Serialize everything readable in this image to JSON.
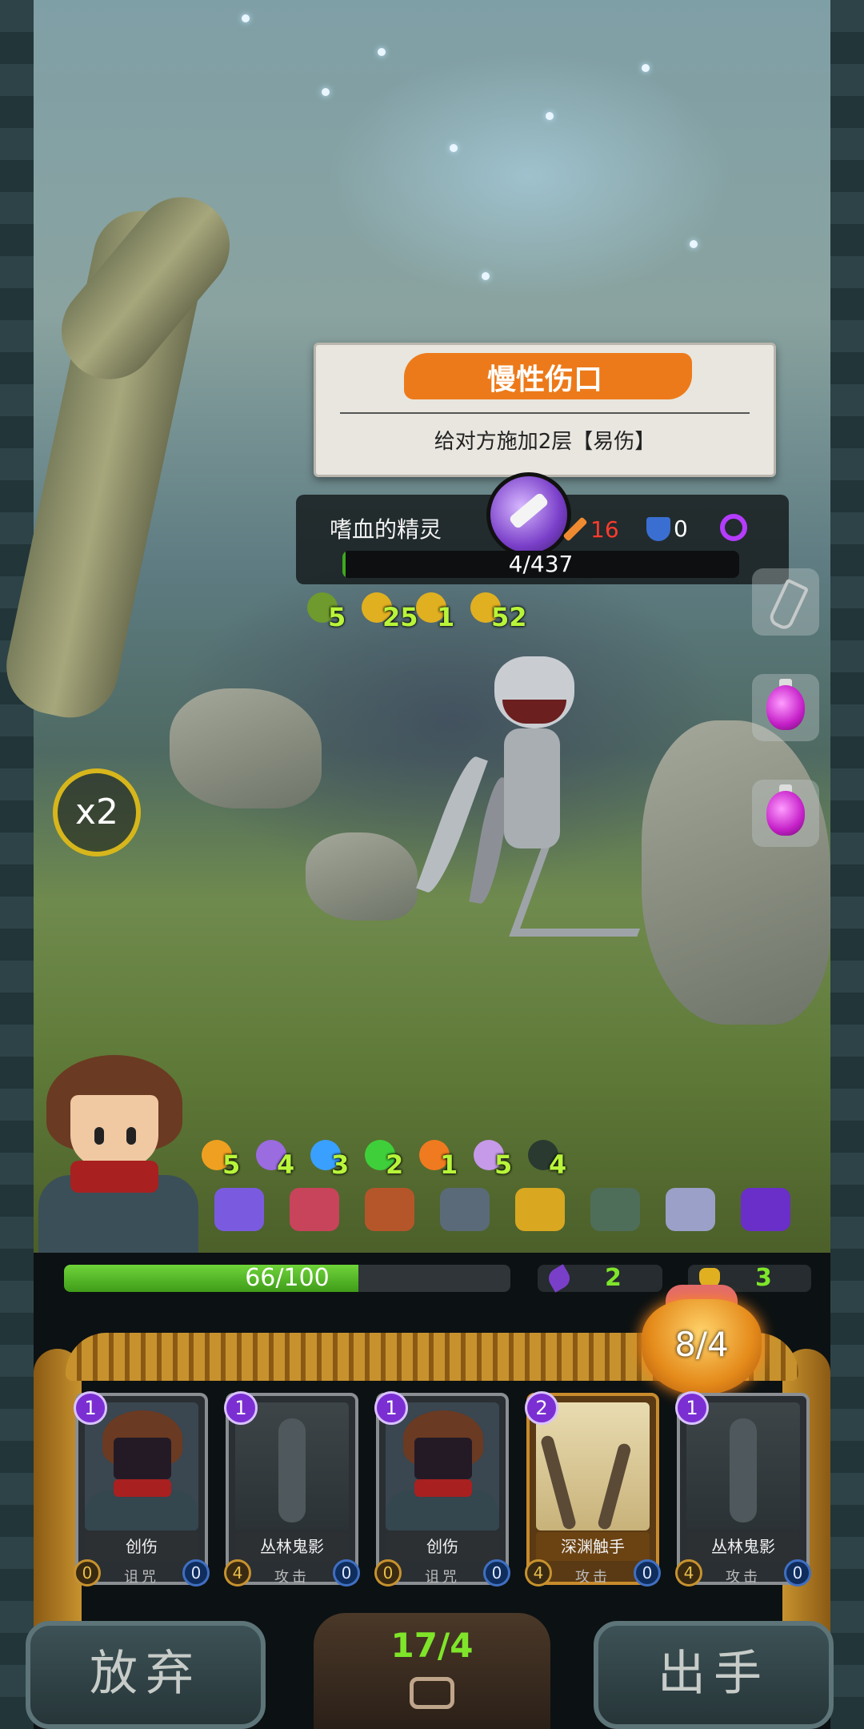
{
  "tooltip": {
    "title": "慢性伤口",
    "description": "给对方施加2层【易伤】"
  },
  "enemy": {
    "name": "嗜血的精灵",
    "attack": "16",
    "defense": "0",
    "hp_text": "4/437",
    "hp_fraction": 0.009,
    "buffs": [
      {
        "icon": "thorn-icon",
        "value": "5",
        "color": "#6e9a2e"
      },
      {
        "icon": "muscle-icon",
        "value": "25",
        "color": "#e0b020"
      },
      {
        "icon": "heart-icon",
        "value": "1",
        "color": "#e0b020"
      },
      {
        "icon": "serpent-icon",
        "value": "52",
        "color": "#e0b020"
      }
    ]
  },
  "speed": {
    "label": "x2"
  },
  "player": {
    "hp_text": "66/100",
    "hp_fraction": 0.66,
    "armor": "2",
    "strength": "3",
    "buffs": [
      {
        "icon": "fist-icon",
        "value": "5",
        "color": "#f0a020"
      },
      {
        "icon": "feather-icon",
        "value": "4",
        "color": "#9b6be0"
      },
      {
        "icon": "flame-blue-icon",
        "value": "3",
        "color": "#3aa0ff"
      },
      {
        "icon": "heal-heart-icon",
        "value": "2",
        "color": "#3fcf3a"
      },
      {
        "icon": "fire-icon",
        "value": "1",
        "color": "#f07a20"
      },
      {
        "icon": "spirit-icon",
        "value": "5",
        "color": "#c69ae8"
      },
      {
        "icon": "crow-icon",
        "value": "4",
        "color": "#2a3a30"
      }
    ],
    "relics": [
      {
        "icon": "scroll-relic-icon",
        "color": "#7a5be0"
      },
      {
        "icon": "flower-relic-icon",
        "color": "#c8445a"
      },
      {
        "icon": "belt-relic-icon",
        "color": "#b5562a"
      },
      {
        "icon": "boot-relic-icon",
        "color": "#5a6a78"
      },
      {
        "icon": "tome-relic-icon",
        "color": "#d9a820"
      },
      {
        "icon": "rune-relic-icon",
        "color": "#4e6e5a"
      },
      {
        "icon": "shuriken-relic-icon",
        "color": "#9aa0c8"
      },
      {
        "icon": "vortex-relic-icon",
        "color": "#6a2fc8"
      }
    ]
  },
  "energy": {
    "text": "8/4"
  },
  "cards": [
    {
      "cost": "1",
      "name": "创伤",
      "type": "诅咒",
      "left_value": "0",
      "right_value": "0",
      "art": "hero",
      "style": "grey"
    },
    {
      "cost": "1",
      "name": "丛林鬼影",
      "type": "攻击",
      "left_value": "4",
      "right_value": "0",
      "art": "ghost",
      "style": "grey"
    },
    {
      "cost": "1",
      "name": "创伤",
      "type": "诅咒",
      "left_value": "0",
      "right_value": "0",
      "art": "hero",
      "style": "grey"
    },
    {
      "cost": "2",
      "name": "深渊触手",
      "type": "攻击",
      "left_value": "4",
      "right_value": "0",
      "art": "abyss",
      "style": "gold"
    },
    {
      "cost": "1",
      "name": "丛林鬼影",
      "type": "攻击",
      "left_value": "4",
      "right_value": "0",
      "art": "ghost",
      "style": "grey"
    }
  ],
  "deck": {
    "count_text": "17/4"
  },
  "buttons": {
    "give_up": "放弃",
    "play": "出手"
  }
}
